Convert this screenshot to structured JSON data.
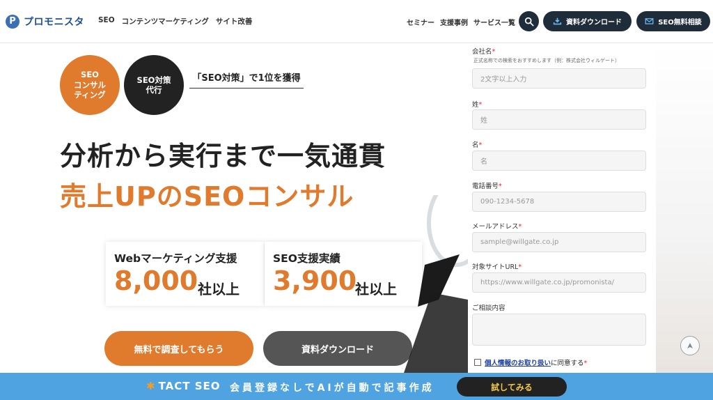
{
  "header": {
    "logo_text": "プロモニスタ",
    "nav_left": [
      "SEO",
      "コンテンツマーケティング",
      "サイト改善"
    ],
    "nav_right": [
      "セミナー",
      "支援事例",
      "サービス一覧"
    ],
    "download_label": "資料ダウンロード",
    "consult_label": "SEO無料相談"
  },
  "hero": {
    "badge_seo_consulting": "SEO\nコンサル\nティング",
    "badge_seo_agency": "SEO対策\n代行",
    "tagline": "「SEO対策」で1位を獲得",
    "headline_line1": "分析から実行まで一気通貫",
    "headline_line2": "売上UPのSEOコンサル",
    "stats": [
      {
        "label": "Webマーケティング支援",
        "value": "8,000",
        "suffix": "社以上"
      },
      {
        "label": "SEO支援実績",
        "value": "3,900",
        "suffix": "社以上"
      }
    ],
    "cta_primary": "無料で調査してもらう",
    "cta_secondary": "資料ダウンロード"
  },
  "form": {
    "company_label": "会社名",
    "company_hint": "正式名称での検索をおすすめします（例：株式会社ウィルゲート）",
    "company_placeholder": "2文字以上入力",
    "last_name_label": "姓",
    "last_name_placeholder": "姓",
    "first_name_label": "名",
    "first_name_placeholder": "名",
    "phone_label": "電話番号",
    "phone_placeholder": "090-1234-5678",
    "email_label": "メールアドレス",
    "email_placeholder": "sample@willgate.co.jp",
    "site_url_label": "対象サイトURL",
    "site_url_placeholder": "https://www.willgate.co.jp/promonista/",
    "consult_label": "ご相談内容",
    "privacy_link": "個人情報のお取り扱い",
    "privacy_suffix": "に同意する",
    "required_mark": "*"
  },
  "banner": {
    "logo_text": "TACT SEO",
    "text": "会員登録なしでAIが自動で記事作成",
    "button_label": "試してみる"
  },
  "colors": {
    "accent_orange": "#e07a2c",
    "dark_navy": "#1f2d3b",
    "banner_blue": "#4fa3e0",
    "required_red": "#e0252c"
  },
  "icons": [
    "logo-icon",
    "search-icon",
    "download-icon",
    "mail-icon",
    "arrow-up-icon",
    "star-icon"
  ]
}
